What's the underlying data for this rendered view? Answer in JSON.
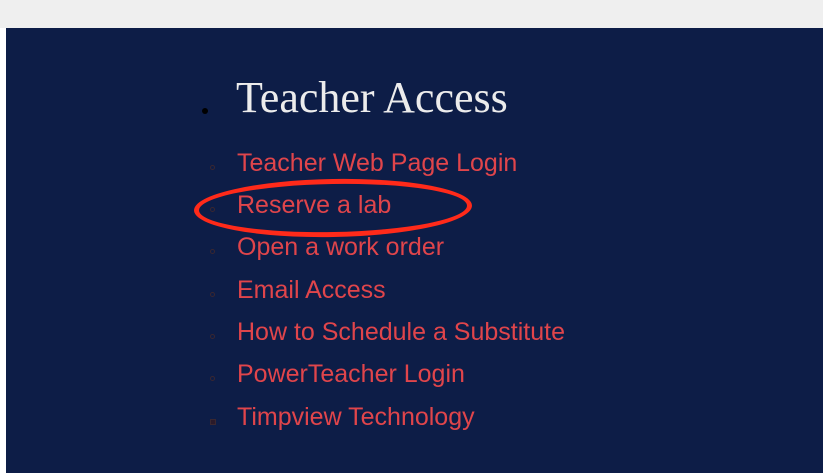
{
  "section": {
    "title": "Teacher Access",
    "links": [
      {
        "label": "Teacher Web Page Login",
        "bullet": "circle"
      },
      {
        "label": "Reserve a lab",
        "bullet": "circle"
      },
      {
        "label": "Open a work order",
        "bullet": "circle"
      },
      {
        "label": "Email Access",
        "bullet": "circle"
      },
      {
        "label": "How to Schedule a Substitute",
        "bullet": "circle"
      },
      {
        "label": "PowerTeacher Login",
        "bullet": "circle"
      },
      {
        "label": "Timpview Technology",
        "bullet": "square"
      }
    ]
  },
  "colors": {
    "panel_background": "#0d1d47",
    "heading": "#ececec",
    "link": "#e0454b",
    "annotation_circle": "#ff2a1a",
    "top_strip": "#efefef"
  },
  "annotation": {
    "highlighted_link": "Reserve a lab",
    "shape": "hand-drawn-ellipse"
  }
}
